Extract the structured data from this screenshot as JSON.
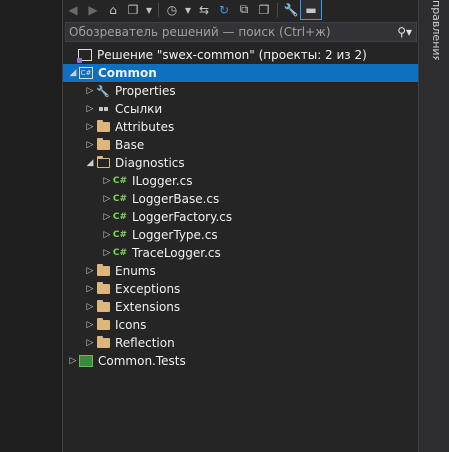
{
  "right_tab": {
    "label": "правления"
  },
  "search": {
    "placeholder": "Обозреватель решений — поиск (Ctrl+ж)"
  },
  "tree": [
    {
      "label": "Решение \"swex-common\" (проекты: 2 из 2)",
      "icon": "solution-icon",
      "expander": "none",
      "indent": 0
    },
    {
      "label": "Common",
      "icon": "csharp-project-icon",
      "expander": "expanded",
      "indent": 1,
      "selected": true
    },
    {
      "label": "Properties",
      "icon": "wrench-icon",
      "expander": "collapsed",
      "indent": 2
    },
    {
      "label": "Ссылки",
      "icon": "references-icon",
      "expander": "collapsed",
      "indent": 2
    },
    {
      "label": "Attributes",
      "icon": "folder-icon",
      "expander": "collapsed",
      "indent": 2
    },
    {
      "label": "Base",
      "icon": "folder-icon",
      "expander": "collapsed",
      "indent": 2
    },
    {
      "label": "Diagnostics",
      "icon": "folder-open-icon",
      "expander": "expanded",
      "indent": 2
    },
    {
      "label": "ILogger.cs",
      "icon": "csharp-file-icon",
      "expander": "collapsed",
      "indent": 3
    },
    {
      "label": "LoggerBase.cs",
      "icon": "csharp-file-icon",
      "expander": "collapsed",
      "indent": 3
    },
    {
      "label": "LoggerFactory.cs",
      "icon": "csharp-file-icon",
      "expander": "collapsed",
      "indent": 3
    },
    {
      "label": "LoggerType.cs",
      "icon": "csharp-file-icon",
      "expander": "collapsed",
      "indent": 3
    },
    {
      "label": "TraceLogger.cs",
      "icon": "csharp-file-icon",
      "expander": "collapsed",
      "indent": 3
    },
    {
      "label": "Enums",
      "icon": "folder-icon",
      "expander": "collapsed",
      "indent": 2
    },
    {
      "label": "Exceptions",
      "icon": "folder-icon",
      "expander": "collapsed",
      "indent": 2
    },
    {
      "label": "Extensions",
      "icon": "folder-icon",
      "expander": "collapsed",
      "indent": 2
    },
    {
      "label": "Icons",
      "icon": "folder-icon",
      "expander": "collapsed",
      "indent": 2
    },
    {
      "label": "Reflection",
      "icon": "folder-icon",
      "expander": "collapsed",
      "indent": 2
    },
    {
      "label": "Common.Tests",
      "icon": "test-project-icon",
      "expander": "collapsed",
      "indent": 1
    }
  ]
}
